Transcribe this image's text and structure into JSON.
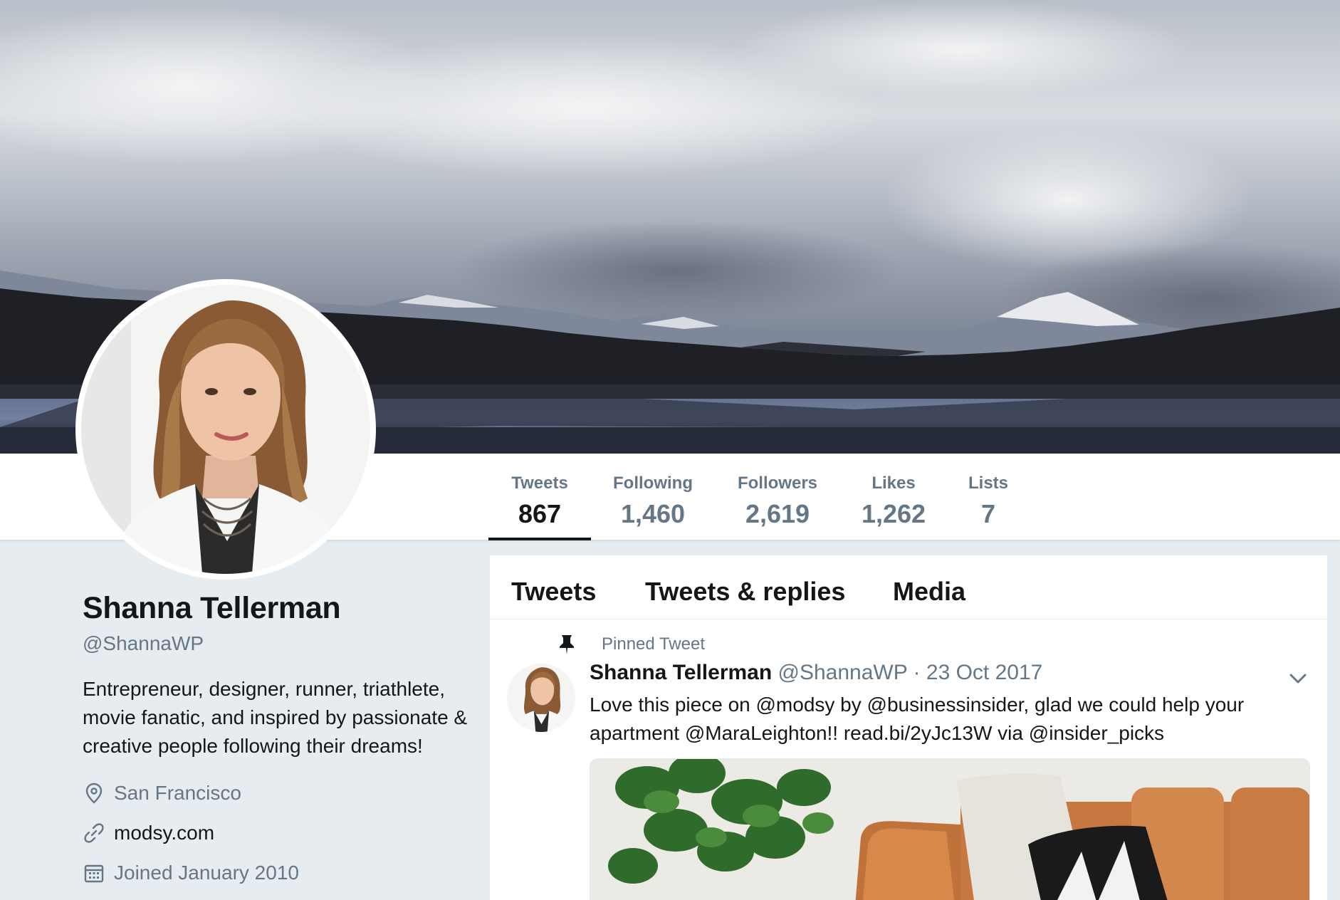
{
  "profile": {
    "name": "Shanna Tellerman",
    "handle": "@ShannaWP",
    "bio": "Entrepreneur, designer, runner, triathlete, movie fanatic, and inspired by passionate & creative people following their dreams!",
    "location": "San Francisco",
    "website": "modsy.com",
    "joined": "Joined January 2010"
  },
  "stats": [
    {
      "label": "Tweets",
      "value": "867",
      "active": true
    },
    {
      "label": "Following",
      "value": "1,460",
      "active": false
    },
    {
      "label": "Followers",
      "value": "2,619",
      "active": false
    },
    {
      "label": "Likes",
      "value": "1,262",
      "active": false
    },
    {
      "label": "Lists",
      "value": "7",
      "active": false
    }
  ],
  "timeline": {
    "tabs": [
      "Tweets",
      "Tweets & replies",
      "Media"
    ],
    "pinned_label": "Pinned Tweet",
    "tweet": {
      "author_name": "Shanna Tellerman",
      "author_handle": "@ShannaWP",
      "separator": "·",
      "date": "23 Oct 2017",
      "text_parts": {
        "p1": "Love this piece on ",
        "m1": "@modsy",
        "p2": " by ",
        "m2": "@businessinsider",
        "p3": ", glad we could help your apartment ",
        "m3": "@MaraLeighton",
        "p4": "!! ",
        "link": "read.bi/2yJc13W",
        "p5": " via ",
        "m4": "@insider_picks"
      }
    }
  },
  "icons": {
    "location": "map-pin-icon",
    "website": "link-icon",
    "joined": "calendar-icon",
    "pinned": "pin-icon",
    "caret": "chevron-down-icon"
  },
  "colors": {
    "primary_text": "#14171a",
    "secondary_text": "#657786",
    "background": "#e6ecf0"
  }
}
